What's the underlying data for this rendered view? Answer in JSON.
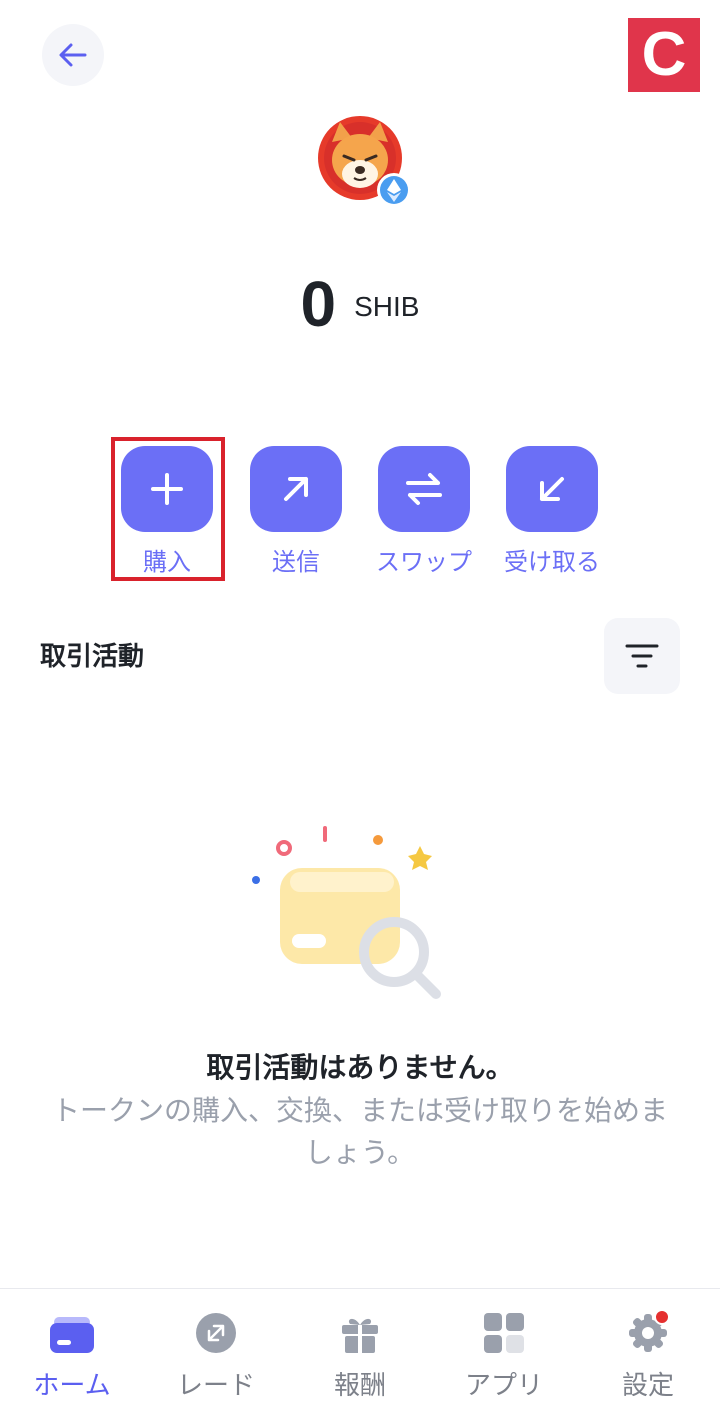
{
  "header": {
    "back_icon": "arrow-left-icon",
    "badge_letter": "C"
  },
  "token": {
    "logo_icon": "shiba-inu-logo",
    "network_icon": "ethereum-network-icon",
    "balance": "0",
    "symbol": "SHIB"
  },
  "actions": [
    {
      "label": "購入",
      "icon": "plus-icon"
    },
    {
      "label": "送信",
      "icon": "arrow-up-right-icon"
    },
    {
      "label": "スワップ",
      "icon": "swap-icon"
    },
    {
      "label": "受け取る",
      "icon": "arrow-down-left-icon"
    }
  ],
  "activity": {
    "title": "取引活動",
    "filter_icon": "filter-icon",
    "empty_title": "取引活動はありません。",
    "empty_desc": "トークンの購入、交換、または受け取りを始めましょう。"
  },
  "bottom_nav": [
    {
      "label": "ホーム",
      "icon": "wallet-icon",
      "active": true
    },
    {
      "label": "レード",
      "icon": "trade-icon",
      "active": false
    },
    {
      "label": "報酬",
      "icon": "gift-icon",
      "active": false
    },
    {
      "label": "アプリ",
      "icon": "apps-grid-icon",
      "active": false
    },
    {
      "label": "設定",
      "icon": "gear-icon",
      "active": false,
      "badge": true
    }
  ],
  "colors": {
    "accent": "#6b6ff6",
    "nav_active": "#5b5ff0",
    "highlight": "#d9222c",
    "brand_badge": "#e0354b"
  }
}
